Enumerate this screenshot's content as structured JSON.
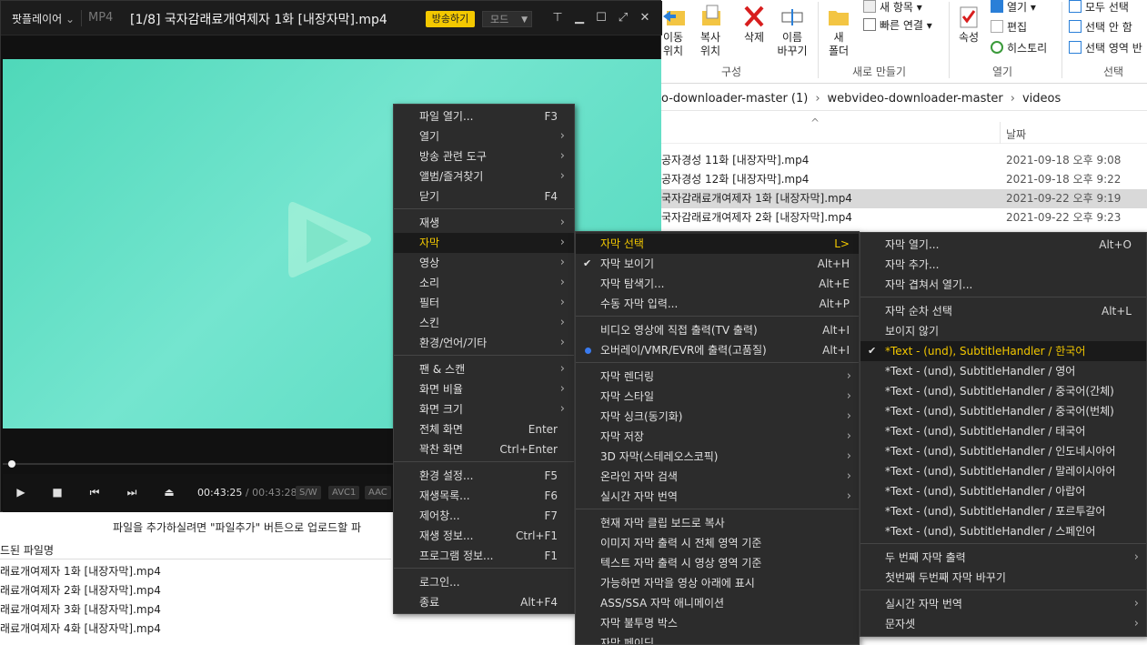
{
  "explorer": {
    "ribbon": {
      "move_to": "이동\n위치",
      "copy_to": "복사\n위치",
      "delete": "삭제",
      "rename": "이름\n바꾸기",
      "organize_group": "구성",
      "new_folder": "새\n폴더",
      "new_item": "새 항목",
      "easy_access": "빠른 연결",
      "new_group": "새로 만들기",
      "properties": "속성",
      "open": "열기",
      "edit": "편집",
      "history": "히스토리",
      "open_group": "열기",
      "select_all": "모두 선택",
      "select_none": "선택 안 함",
      "invert_selection": "선택 영역 반",
      "select_group": "선택"
    },
    "address": [
      "o-downloader-master (1)",
      "webvideo-downloader-master",
      "videos"
    ],
    "column_date": "날짜",
    "files": [
      {
        "name": "공자경성 11화 [내장자막].mp4",
        "date": "2021-09-18 오후 9:08"
      },
      {
        "name": "공자경성 12화 [내장자막].mp4",
        "date": "2021-09-18 오후 9:22"
      },
      {
        "name": "국자감래료개여제자 1화 [내장자막].mp4",
        "date": "2021-09-22 오후 9:19"
      },
      {
        "name": "국자감래료개여제자 2화 [내장자막].mp4",
        "date": "2021-09-22 오후 9:23"
      }
    ]
  },
  "uploader": {
    "message": "파일을 추가하실려면 \"파일추가\" 버튼으로 업로드할 파",
    "header": "드된 파일명",
    "items": [
      "래료개여제자 1화 [내장자막].mp4",
      "래료개여제자 2화 [내장자막].mp4",
      "래료개여제자 3화 [내장자막].mp4",
      "래료개여제자 4화 [내장자막].mp4"
    ]
  },
  "player": {
    "brand": "팟플레이어",
    "format": "MP4",
    "title": "[1/8] 국자감래료개여제자 1화 [내장자막].mp4",
    "live_button": "방송하기",
    "mode_button": "모드",
    "time_current": "00:43:25",
    "time_separator": "/",
    "time_total": "00:43:28",
    "tags": [
      "S/W",
      "AVC1",
      "AAC"
    ],
    "progress": 0.0
  },
  "main_menu": [
    {
      "label": "파일 열기...",
      "shortcut": "F3"
    },
    {
      "label": "열기",
      "arrow": true
    },
    {
      "label": "방송 관련 도구",
      "arrow": true
    },
    {
      "label": "앨범/즐겨찾기",
      "arrow": true
    },
    {
      "label": "닫기",
      "shortcut": "F4"
    },
    {
      "sep": true
    },
    {
      "label": "재생",
      "arrow": true
    },
    {
      "label": "자막",
      "arrow": true,
      "highlight": true
    },
    {
      "label": "영상",
      "arrow": true
    },
    {
      "label": "소리",
      "arrow": true
    },
    {
      "label": "필터",
      "arrow": true
    },
    {
      "label": "스킨",
      "arrow": true
    },
    {
      "label": "환경/언어/기타",
      "arrow": true
    },
    {
      "sep": true
    },
    {
      "label": "팬 & 스캔",
      "arrow": true
    },
    {
      "label": "화면 비율",
      "arrow": true
    },
    {
      "label": "화면 크기",
      "arrow": true
    },
    {
      "label": "전체 화면",
      "shortcut": "Enter"
    },
    {
      "label": "꽉찬 화면",
      "shortcut": "Ctrl+Enter"
    },
    {
      "sep": true
    },
    {
      "label": "환경 설정...",
      "shortcut": "F5"
    },
    {
      "label": "재생목록...",
      "shortcut": "F6"
    },
    {
      "label": "제어창...",
      "shortcut": "F7"
    },
    {
      "label": "재생 정보...",
      "shortcut": "Ctrl+F1"
    },
    {
      "label": "프로그램 정보...",
      "shortcut": "F1"
    },
    {
      "sep": true
    },
    {
      "label": "로그인..."
    },
    {
      "label": "종료",
      "shortcut": "Alt+F4"
    }
  ],
  "subtitle_menu": [
    {
      "label": "자막 선택",
      "shortcut": "L>",
      "highlight": true
    },
    {
      "label": "자막 보이기",
      "shortcut": "Alt+H",
      "check": true
    },
    {
      "label": "자막 탐색기...",
      "shortcut": "Alt+E"
    },
    {
      "label": "수동 자막 입력...",
      "shortcut": "Alt+P"
    },
    {
      "sep": true
    },
    {
      "label": "비디오 영상에 직접 출력(TV 출력)",
      "shortcut": "Alt+I"
    },
    {
      "label": "오버레이/VMR/EVR에 출력(고품질)",
      "shortcut": "Alt+I",
      "radio": true
    },
    {
      "sep": true
    },
    {
      "label": "자막 렌더링",
      "arrow": true
    },
    {
      "label": "자막 스타일",
      "arrow": true
    },
    {
      "label": "자막 싱크(동기화)",
      "arrow": true
    },
    {
      "label": "자막 저장",
      "arrow": true
    },
    {
      "label": "3D 자막(스테레오스코픽)",
      "arrow": true
    },
    {
      "label": "온라인 자막 검색",
      "arrow": true
    },
    {
      "label": "실시간 자막 번역",
      "arrow": true
    },
    {
      "sep": true
    },
    {
      "label": "현재 자막 클립 보드로 복사"
    },
    {
      "label": "이미지 자막 출력 시 전체 영역 기준"
    },
    {
      "label": "텍스트 자막 출력 시 영상 영역 기준"
    },
    {
      "label": "가능하면 자막을 영상 아래에 표시"
    },
    {
      "label": "ASS/SSA 자막 애니메이션"
    },
    {
      "label": "자막 불투명 박스"
    },
    {
      "label": "자막 페이딩"
    }
  ],
  "select_menu": [
    {
      "label": "자막 열기...",
      "shortcut": "Alt+O"
    },
    {
      "label": "자막 추가..."
    },
    {
      "label": "자막 겹쳐서 열기..."
    },
    {
      "sep": true
    },
    {
      "label": "자막 순차 선택",
      "shortcut": "Alt+L"
    },
    {
      "label": "보이지 않기"
    },
    {
      "label": "*Text -  (und), SubtitleHandler / 한국어",
      "check": true,
      "highlight": true
    },
    {
      "label": "*Text -  (und), SubtitleHandler / 영어"
    },
    {
      "label": "*Text -  (und), SubtitleHandler / 중국어(간체)"
    },
    {
      "label": "*Text -  (und), SubtitleHandler / 중국어(번체)"
    },
    {
      "label": "*Text -  (und), SubtitleHandler / 태국어"
    },
    {
      "label": "*Text -  (und), SubtitleHandler / 인도네시아어"
    },
    {
      "label": "*Text -  (und), SubtitleHandler / 말레이시아어"
    },
    {
      "label": "*Text -  (und), SubtitleHandler / 아랍어"
    },
    {
      "label": "*Text -  (und), SubtitleHandler / 포르투갈어"
    },
    {
      "label": "*Text -  (und), SubtitleHandler / 스페인어"
    },
    {
      "sep": true
    },
    {
      "label": "두 번째 자막 출력",
      "arrow": true
    },
    {
      "label": "첫번째 두번째 자막 바꾸기"
    },
    {
      "sep": true
    },
    {
      "label": "실시간 자막 번역",
      "arrow": true
    },
    {
      "label": "문자셋",
      "arrow": true
    }
  ]
}
